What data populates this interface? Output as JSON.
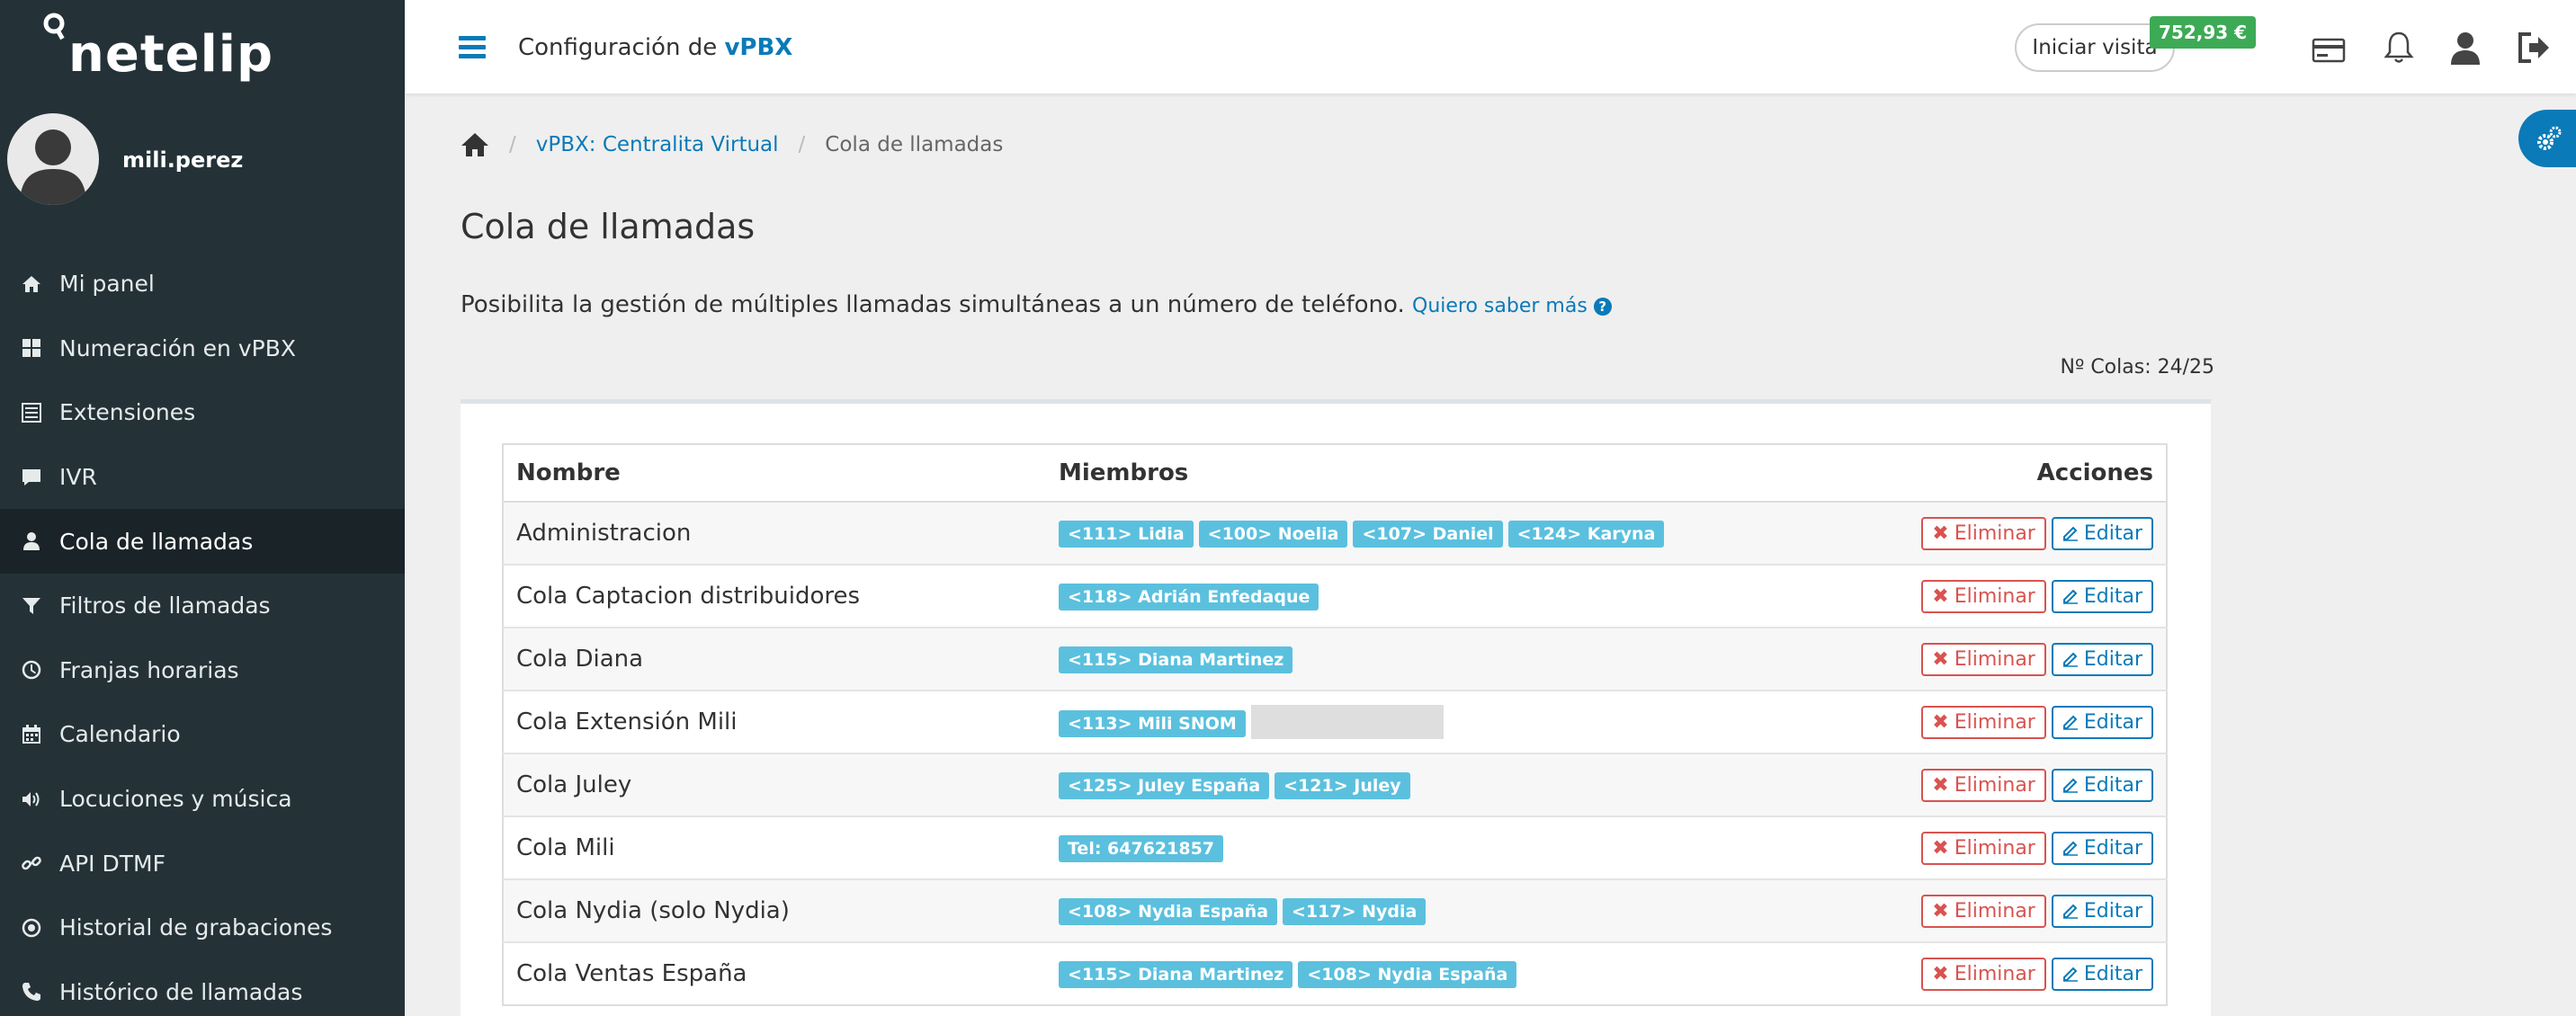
{
  "brand": {
    "logo_text": "netelip"
  },
  "user": {
    "name": "mili.perez"
  },
  "sidebar": {
    "items": [
      {
        "label": "Mi panel",
        "icon": "home-icon"
      },
      {
        "label": "Numeración en vPBX",
        "icon": "grid-icon"
      },
      {
        "label": "Extensiones",
        "icon": "list-icon"
      },
      {
        "label": "IVR",
        "icon": "comment-icon"
      },
      {
        "label": "Cola de llamadas",
        "icon": "user-icon",
        "active": true
      },
      {
        "label": "Filtros de llamadas",
        "icon": "filter-icon"
      },
      {
        "label": "Franjas horarias",
        "icon": "clock-icon"
      },
      {
        "label": "Calendario",
        "icon": "calendar-icon"
      },
      {
        "label": "Locuciones y música",
        "icon": "volume-icon"
      },
      {
        "label": "API DTMF",
        "icon": "link-icon"
      },
      {
        "label": "Historial de grabaciones",
        "icon": "record-icon"
      },
      {
        "label": "Histórico de llamadas",
        "icon": "phone-icon"
      }
    ]
  },
  "header": {
    "title_prefix": "Configuración de",
    "title_strong": "vPBX",
    "visit_button": "Iniciar visita",
    "balance": "752,93 €"
  },
  "breadcrumb": {
    "link": "vPBX: Centralita Virtual",
    "current": "Cola de llamadas"
  },
  "page": {
    "title": "Cola de llamadas",
    "description": "Posibilita la gestión de múltiples llamadas simultáneas a un número de teléfono.",
    "more_link": "Quiero saber más",
    "count": "Nº Colas: 24/25"
  },
  "table": {
    "headers": {
      "name": "Nombre",
      "members": "Miembros",
      "actions": "Acciones"
    },
    "delete_label": "Eliminar",
    "edit_label": "Editar",
    "rows": [
      {
        "name": "Administracion",
        "members": [
          "<111> Lidia",
          "<100> Noelia",
          "<107> Daniel",
          "<124> Karyna"
        ]
      },
      {
        "name": "Cola Captacion distribuidores",
        "members": [
          "<118> Adrián Enfedaque"
        ]
      },
      {
        "name": "Cola Diana",
        "members": [
          "<115> Diana Martinez"
        ]
      },
      {
        "name": "Cola Extensión Mili",
        "members": [
          "<113> Mili SNOM"
        ],
        "redacted": true
      },
      {
        "name": "Cola Juley",
        "members": [
          "<125> Juley España",
          "<121> Juley"
        ]
      },
      {
        "name": "Cola Mili",
        "members": [
          "Tel: 647621857"
        ]
      },
      {
        "name": "Cola Nydia (solo Nydia)",
        "members": [
          "<108> Nydia España",
          "<117> Nydia"
        ]
      },
      {
        "name": "Cola Ventas España",
        "members": [
          "<115> Diana Martinez",
          "<108> Nydia España"
        ]
      }
    ]
  },
  "colors": {
    "sidebar_bg": "#243238",
    "accent": "#0a7ab8",
    "badge": "#5bc0de",
    "danger": "#d9534f",
    "balance": "#3daa55"
  }
}
